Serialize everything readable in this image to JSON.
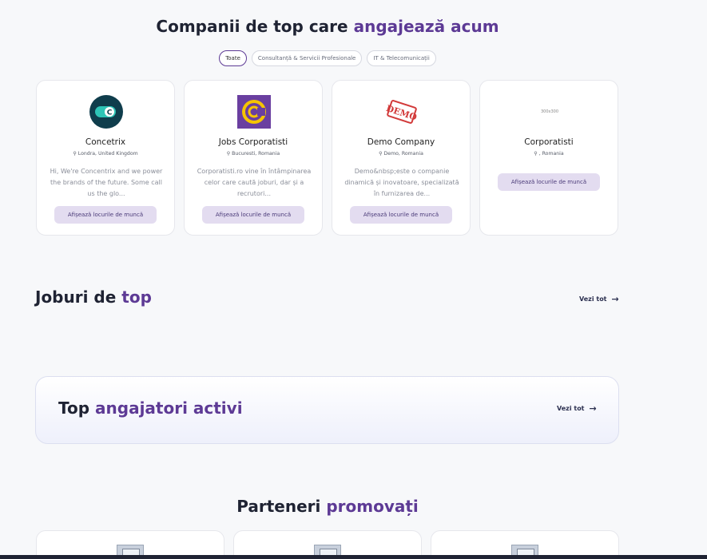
{
  "companies_section": {
    "title_part1": "Companii de top care ",
    "title_accent": "angajează acum",
    "filters": [
      {
        "label": "Toate",
        "active": true
      },
      {
        "label": "Consultanță & Servicii Profesionale",
        "active": false
      },
      {
        "label": "IT & Telecomunicații",
        "active": false
      }
    ],
    "cards": [
      {
        "name": "Concetrix",
        "location": "Londra, United Kingdom",
        "description": "Hi, We're Concentrix and we power the brands of the future. Some call us the glo...",
        "button": "Afișează locurile de muncă",
        "logo": "concentrix-logo"
      },
      {
        "name": "Jobs Corporatisti",
        "location": "Bucuresti, Romania",
        "description": "Corporatisti.ro vine în întâmpinarea celor care caută joburi, dar și a recrutori...",
        "button": "Afișează locurile de muncă",
        "logo": "corporatisti-logo"
      },
      {
        "name": "Demo Company",
        "location": "Demo, Romania",
        "description": "Demo&nbsp;este o companie dinamică și inovatoare, specializată în furnizarea de...",
        "button": "Afișează locurile de muncă",
        "logo": "demo-stamp-logo",
        "logo_text": "DEMO"
      },
      {
        "name": "Corporatisti",
        "location": ", Romania",
        "description": "",
        "button": "Afișează locurile de muncă",
        "logo": "placeholder-logo",
        "logo_text": "300x300"
      }
    ]
  },
  "jobs_section": {
    "title_part1": "Joburi de ",
    "title_accent": "top",
    "see_all": "Vezi tot"
  },
  "employers_banner": {
    "title_part1": "Top ",
    "title_accent": "angajatori activi",
    "see_all": "Vezi tot"
  },
  "partners_section": {
    "title_part1": "Parteneri ",
    "title_accent": "promovați"
  },
  "colors": {
    "accent": "#5d3a95",
    "button_bg": "#e3dcf0",
    "concentrix_teal": "#2ec4b6",
    "concentrix_dark": "#0f3d4c",
    "corporatisti_purple": "#6a3fa0",
    "corporatisti_yellow": "#f5c400",
    "demo_red": "#d23a3a"
  }
}
